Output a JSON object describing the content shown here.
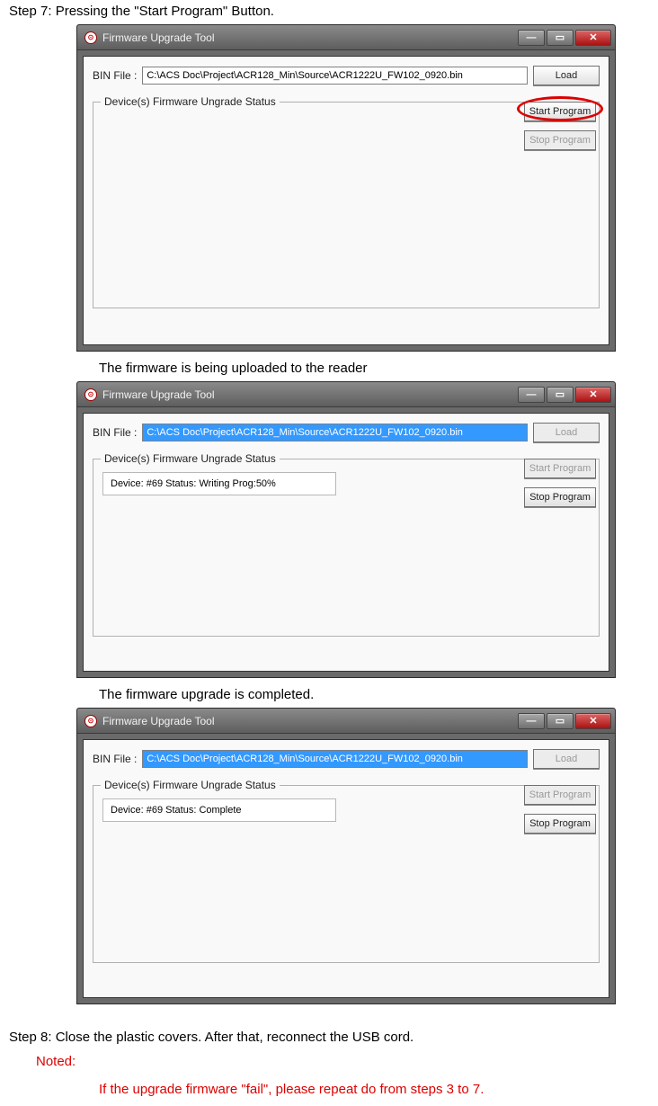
{
  "step7": "Step 7: Pressing the \"Start Program\" Button.",
  "caption1": "The firmware is being uploaded to the reader",
  "caption2": "The firmware upgrade is completed.",
  "step8": "Step 8: Close the plastic covers. After that, reconnect the USB cord.",
  "noted_label": "Noted:",
  "noted_body": "If the upgrade firmware \"fail\", please repeat do from steps 3 to 7.",
  "app": {
    "title": "Firmware Upgrade Tool",
    "bin_label": "BIN File :",
    "bin_path_plain": "C:\\ACS Doc\\Project\\ACR128_Min\\Source\\ACR1222U_FW102_0920.bin",
    "bin_path_sel": "C:\\ACS Doc\\Project\\ACR128_Min\\Source\\ACR1222U_FW102_0920.bin",
    "load_label": "Load",
    "group_title": "Device(s) Firmware Ungrade Status",
    "start_label": "Start Program",
    "stop_label": "Stop Program",
    "status_writing": "Device: #69 Status: Writing Prog:50%",
    "status_complete": "Device: #69 Status: Complete"
  },
  "win_controls": {
    "min": "—",
    "max": "▭",
    "close": "✕"
  }
}
